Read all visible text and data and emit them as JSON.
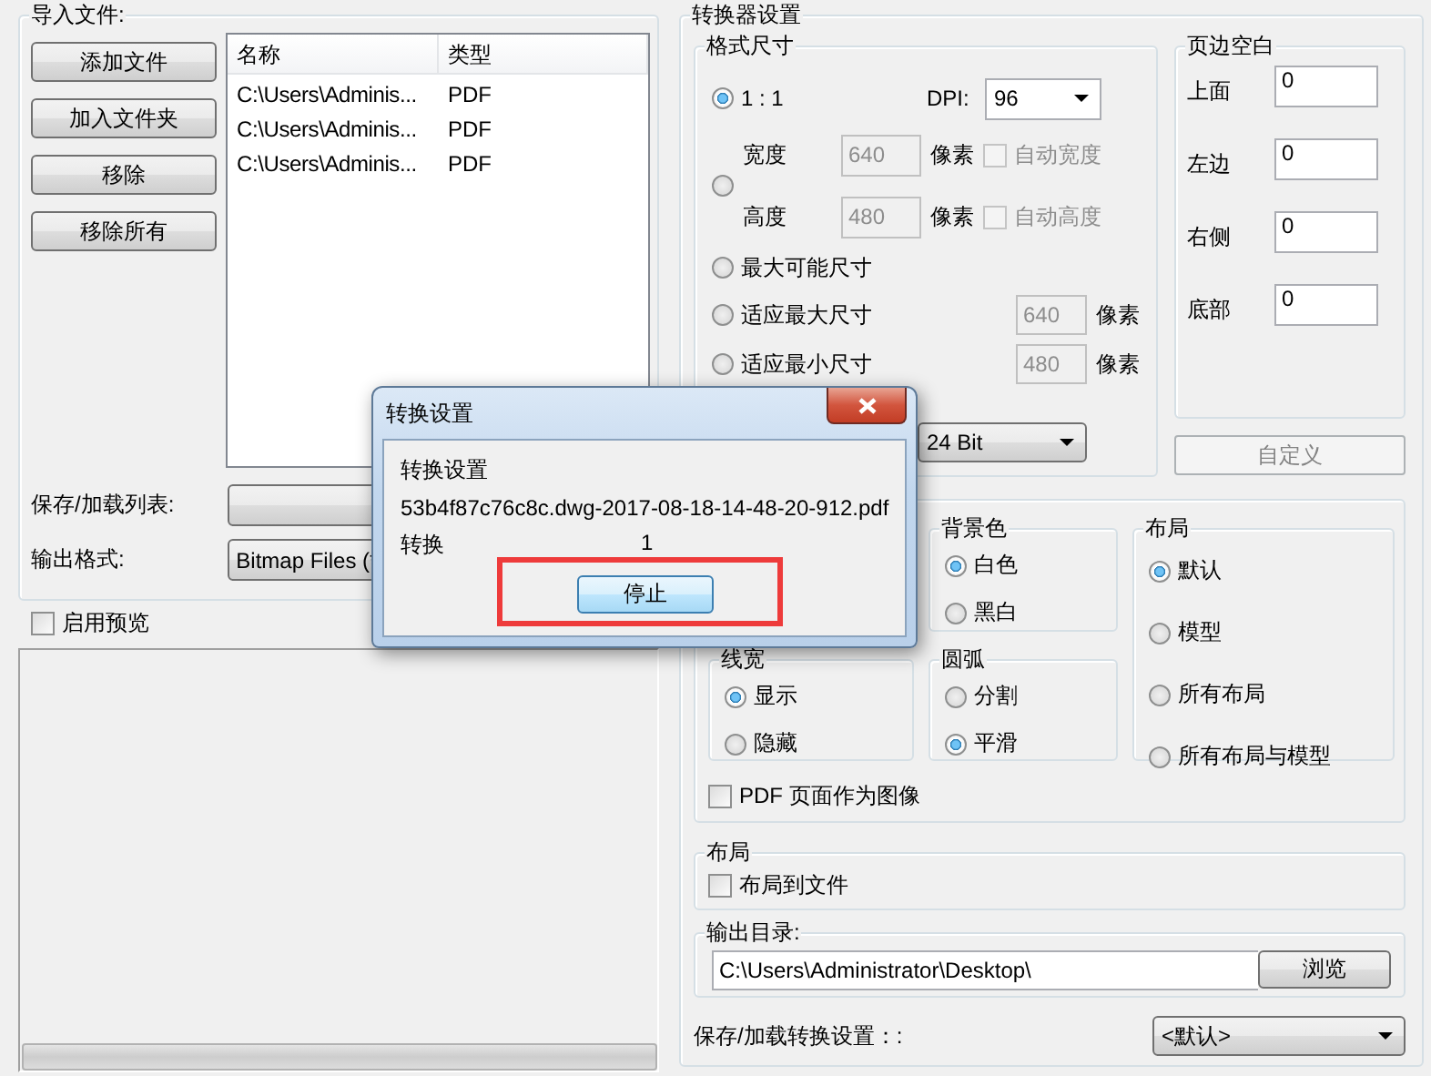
{
  "import_files": {
    "title": "导入文件:",
    "buttons": [
      "添加文件",
      "加入文件夹",
      "移除",
      "移除所有"
    ],
    "columns": [
      "名称",
      "类型"
    ],
    "rows": [
      {
        "name": "C:\\Users\\Adminis...",
        "type": "PDF"
      },
      {
        "name": "C:\\Users\\Adminis...",
        "type": "PDF"
      },
      {
        "name": "C:\\Users\\Adminis...",
        "type": "PDF"
      }
    ],
    "save_load_list": {
      "label": "保存/加载列表:"
    },
    "output_format": {
      "label": "输出格式:",
      "value": "Bitmap Files (*"
    }
  },
  "preview": {
    "label": "启用预览",
    "checked": false,
    "progress": {
      "level": 0
    }
  },
  "converter_settings": {
    "title": "转换器设置",
    "format_size": {
      "title": "格式尺寸",
      "dpi": {
        "label": "DPI:",
        "value": "96"
      },
      "options": [
        {
          "kind": "ratio",
          "label": "1 : 1",
          "selected": true
        },
        {
          "kind": "custom",
          "selected": false,
          "disabled": true,
          "fields": [
            {
              "label": "宽度",
              "value": "640",
              "unit": "像素",
              "auto": "自动宽度",
              "checked": false
            },
            {
              "label": "高度",
              "value": "480",
              "unit": "像素",
              "auto": "自动高度",
              "checked": false
            }
          ]
        },
        {
          "kind": "plain",
          "label": "最大可能尺寸",
          "selected": false
        },
        {
          "kind": "fit",
          "label": "适应最大尺寸",
          "value": "640",
          "unit": "像素",
          "selected": false,
          "disabled": true
        },
        {
          "kind": "fit",
          "label": "适应最小尺寸",
          "value": "480",
          "unit": "像素",
          "selected": false,
          "disabled": true
        }
      ],
      "color_depth": {
        "value": "24 Bit"
      }
    },
    "margins": {
      "title": "页边空白",
      "items": [
        {
          "label": "上面",
          "value": "0"
        },
        {
          "label": "左边",
          "value": "0"
        },
        {
          "label": "右侧",
          "value": "0"
        },
        {
          "label": "底部",
          "value": "0"
        }
      ]
    },
    "custom_button": {
      "label": "自定义",
      "disabled": true
    },
    "line_width": {
      "title": "线宽",
      "options": [
        {
          "label": "显示",
          "selected": true
        },
        {
          "label": "隐藏",
          "selected": false
        }
      ]
    },
    "background": {
      "title": "背景色",
      "options": [
        {
          "label": "白色",
          "selected": true
        },
        {
          "label": "黑白",
          "selected": false
        }
      ]
    },
    "arc": {
      "title": "圆弧",
      "options": [
        {
          "label": "分割",
          "selected": false
        },
        {
          "label": "平滑",
          "selected": true
        }
      ]
    },
    "layout": {
      "title": "布局",
      "options": [
        {
          "label": "默认",
          "selected": true
        },
        {
          "label": "模型",
          "selected": false
        },
        {
          "label": "所有布局",
          "selected": false
        },
        {
          "label": "所有布局与模型",
          "selected": false
        }
      ]
    },
    "pdf_as_image": {
      "label": "PDF 页面作为图像",
      "checked": false
    },
    "layout_output": {
      "title": "布局",
      "to_file": {
        "label": "布局到文件",
        "checked": false
      }
    },
    "output_dir": {
      "title": "输出目录:",
      "value": "C:\\Users\\Administrator\\Desktop\\",
      "browse": "浏览"
    },
    "save_load_settings": {
      "label": "保存/加载转换设置：:",
      "value": "<默认>"
    }
  },
  "dialog": {
    "title": "转换设置",
    "heading": "转换设置",
    "file": "53b4f87c76c8c.dwg-2017-08-18-14-48-20-912.pdf",
    "label": "转换",
    "count": "1",
    "stop": "停止"
  }
}
